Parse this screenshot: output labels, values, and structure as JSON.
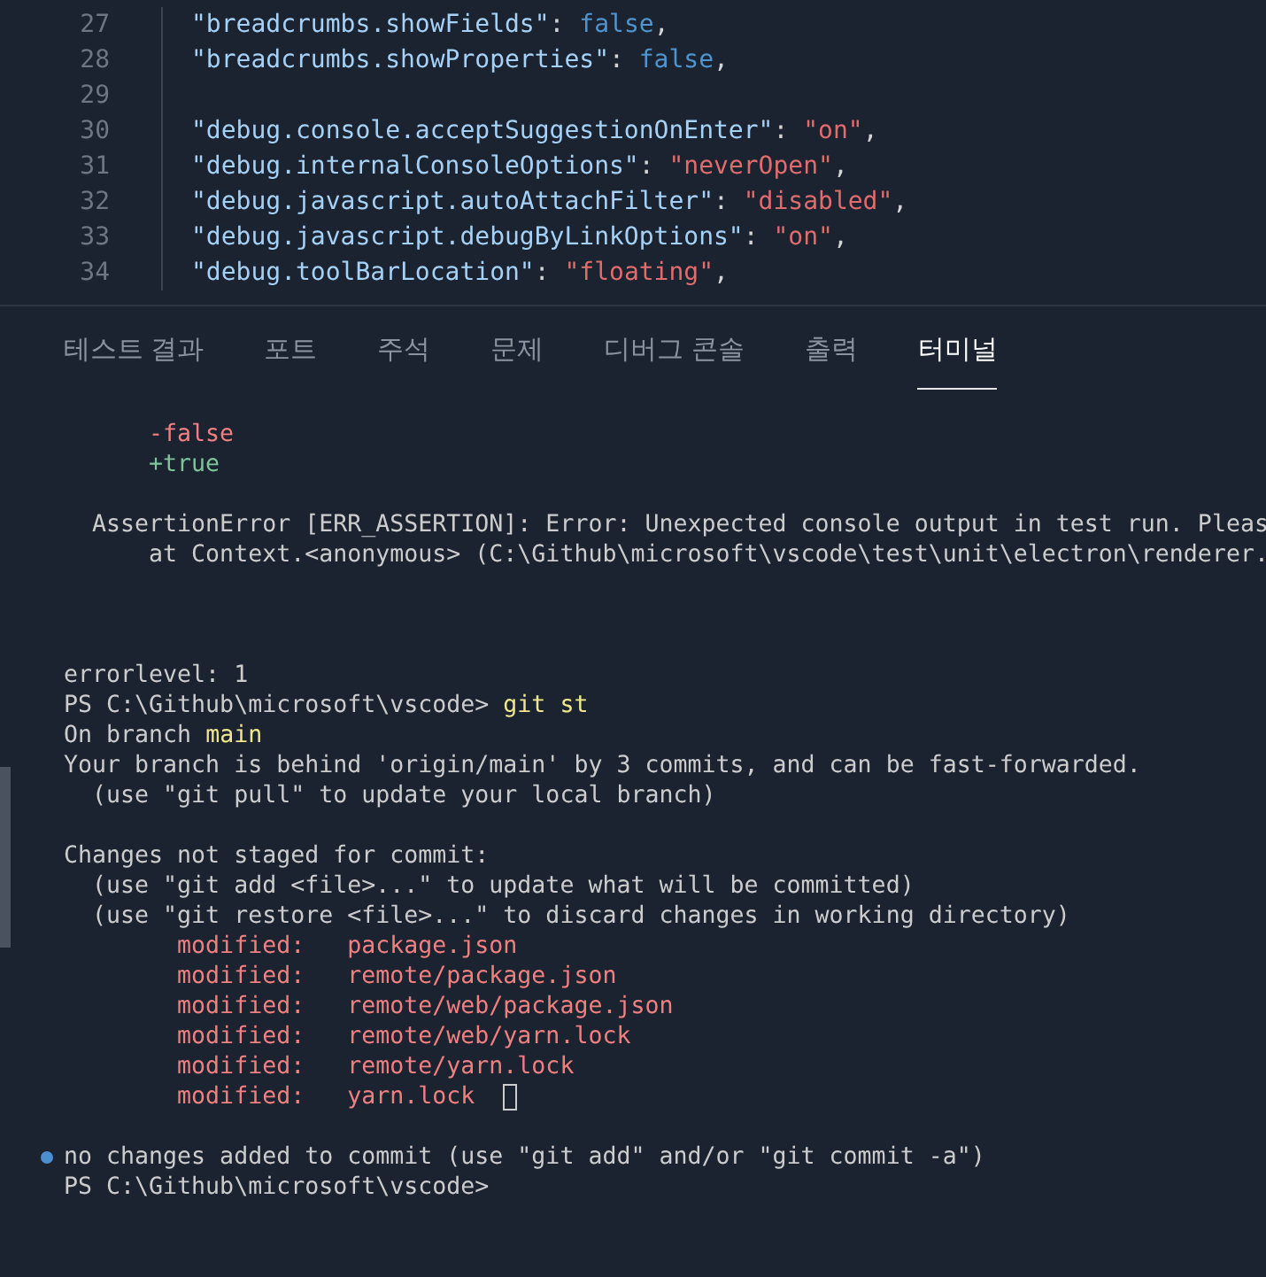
{
  "editor": {
    "lines": [
      {
        "number": "27",
        "tokens": [
          {
            "kind": "key",
            "text": "\"breadcrumbs.showFields\""
          },
          {
            "kind": "punct",
            "text": ": "
          },
          {
            "kind": "keyword",
            "text": "false"
          },
          {
            "kind": "punct",
            "text": ","
          }
        ]
      },
      {
        "number": "28",
        "tokens": [
          {
            "kind": "key",
            "text": "\"breadcrumbs.showProperties\""
          },
          {
            "kind": "punct",
            "text": ": "
          },
          {
            "kind": "keyword",
            "text": "false"
          },
          {
            "kind": "punct",
            "text": ","
          }
        ]
      },
      {
        "number": "29"
      },
      {
        "number": "30",
        "tokens": [
          {
            "kind": "key",
            "text": "\"debug.console.acceptSuggestionOnEnter\""
          },
          {
            "kind": "punct",
            "text": ": "
          },
          {
            "kind": "string",
            "text": "\"on\""
          },
          {
            "kind": "punct",
            "text": ","
          }
        ]
      },
      {
        "number": "31",
        "tokens": [
          {
            "kind": "key",
            "text": "\"debug.internalConsoleOptions\""
          },
          {
            "kind": "punct",
            "text": ": "
          },
          {
            "kind": "string",
            "text": "\"neverOpen\""
          },
          {
            "kind": "punct",
            "text": ","
          }
        ]
      },
      {
        "number": "32",
        "tokens": [
          {
            "kind": "key",
            "text": "\"debug.javascript.autoAttachFilter\""
          },
          {
            "kind": "punct",
            "text": ": "
          },
          {
            "kind": "string",
            "text": "\"disabled\""
          },
          {
            "kind": "punct",
            "text": ","
          }
        ]
      },
      {
        "number": "33",
        "tokens": [
          {
            "kind": "key",
            "text": "\"debug.javascript.debugByLinkOptions\""
          },
          {
            "kind": "punct",
            "text": ": "
          },
          {
            "kind": "string",
            "text": "\"on\""
          },
          {
            "kind": "punct",
            "text": ","
          }
        ]
      },
      {
        "number": "34",
        "tokens": [
          {
            "kind": "key",
            "text": "\"debug.toolBarLocation\""
          },
          {
            "kind": "punct",
            "text": ": "
          },
          {
            "kind": "string",
            "text": "\"floating\""
          },
          {
            "kind": "punct",
            "text": ","
          }
        ]
      }
    ]
  },
  "panel": {
    "tabs": [
      {
        "label": "테스트 결과",
        "selected": false
      },
      {
        "label": "포트",
        "selected": false
      },
      {
        "label": "주석",
        "selected": false
      },
      {
        "label": "문제",
        "selected": false
      },
      {
        "label": "디버그 콘솔",
        "selected": false
      },
      {
        "label": "출력",
        "selected": false
      },
      {
        "label": "터미널",
        "selected": true
      }
    ]
  },
  "terminal": {
    "lines": [
      {
        "kind": "blank"
      },
      {
        "kind": "text",
        "segments": [
          {
            "kind": "removed",
            "text": "      -false"
          }
        ]
      },
      {
        "kind": "text",
        "segments": [
          {
            "kind": "added",
            "text": "      +true"
          }
        ]
      },
      {
        "kind": "blank"
      },
      {
        "kind": "text",
        "segments": [
          {
            "kind": "plain",
            "text": "  AssertionError [ERR_ASSERTION]: Error: Unexpected console output in test run. Pleas"
          }
        ]
      },
      {
        "kind": "text",
        "segments": [
          {
            "kind": "plain",
            "text": "      at Context.<anonymous> (C:\\Github\\microsoft\\vscode\\test\\unit\\electron\\renderer."
          }
        ]
      },
      {
        "kind": "blank"
      },
      {
        "kind": "blank"
      },
      {
        "kind": "blank"
      },
      {
        "kind": "text",
        "segments": [
          {
            "kind": "plain",
            "text": "errorlevel: 1"
          }
        ]
      },
      {
        "kind": "text",
        "segments": [
          {
            "kind": "plain",
            "text": "PS C:\\Github\\microsoft\\vscode> "
          },
          {
            "kind": "command",
            "text": "git st"
          }
        ]
      },
      {
        "kind": "text",
        "segments": [
          {
            "kind": "plain",
            "text": "On branch "
          },
          {
            "kind": "branch",
            "text": "main"
          }
        ]
      },
      {
        "kind": "text",
        "segments": [
          {
            "kind": "plain",
            "text": "Your branch is behind 'origin/main' by 3 commits, and can be fast-forwarded."
          }
        ]
      },
      {
        "kind": "text",
        "segments": [
          {
            "kind": "plain",
            "text": "  (use \"git pull\" to update your local branch)"
          }
        ]
      },
      {
        "kind": "blank"
      },
      {
        "kind": "text",
        "segments": [
          {
            "kind": "plain",
            "text": "Changes not staged for commit:"
          }
        ]
      },
      {
        "kind": "text",
        "segments": [
          {
            "kind": "plain",
            "text": "  (use \"git add <file>...\" to update what will be committed)"
          }
        ]
      },
      {
        "kind": "text",
        "segments": [
          {
            "kind": "plain",
            "text": "  (use \"git restore <file>...\" to discard changes in working directory)"
          }
        ]
      },
      {
        "kind": "text",
        "segments": [
          {
            "kind": "modified",
            "text": "        modified:   package.json"
          }
        ]
      },
      {
        "kind": "text",
        "segments": [
          {
            "kind": "modified",
            "text": "        modified:   remote/package.json"
          }
        ]
      },
      {
        "kind": "text",
        "segments": [
          {
            "kind": "modified",
            "text": "        modified:   remote/web/package.json"
          }
        ]
      },
      {
        "kind": "text",
        "segments": [
          {
            "kind": "modified",
            "text": "        modified:   remote/web/yarn.lock"
          }
        ]
      },
      {
        "kind": "text",
        "segments": [
          {
            "kind": "modified",
            "text": "        modified:   remote/yarn.lock"
          }
        ]
      },
      {
        "kind": "text",
        "cursor": true,
        "segments": [
          {
            "kind": "modified",
            "text": "        modified:   yarn.lock"
          }
        ]
      },
      {
        "kind": "blank"
      },
      {
        "kind": "text",
        "succeeded": true,
        "segments": [
          {
            "kind": "plain",
            "text": "no changes added to commit (use \"git add\" and/or \"git commit -a\")"
          }
        ]
      },
      {
        "kind": "text",
        "segments": [
          {
            "kind": "plain",
            "text": "PS C:\\Github\\microsoft\\vscode>"
          }
        ]
      }
    ]
  }
}
